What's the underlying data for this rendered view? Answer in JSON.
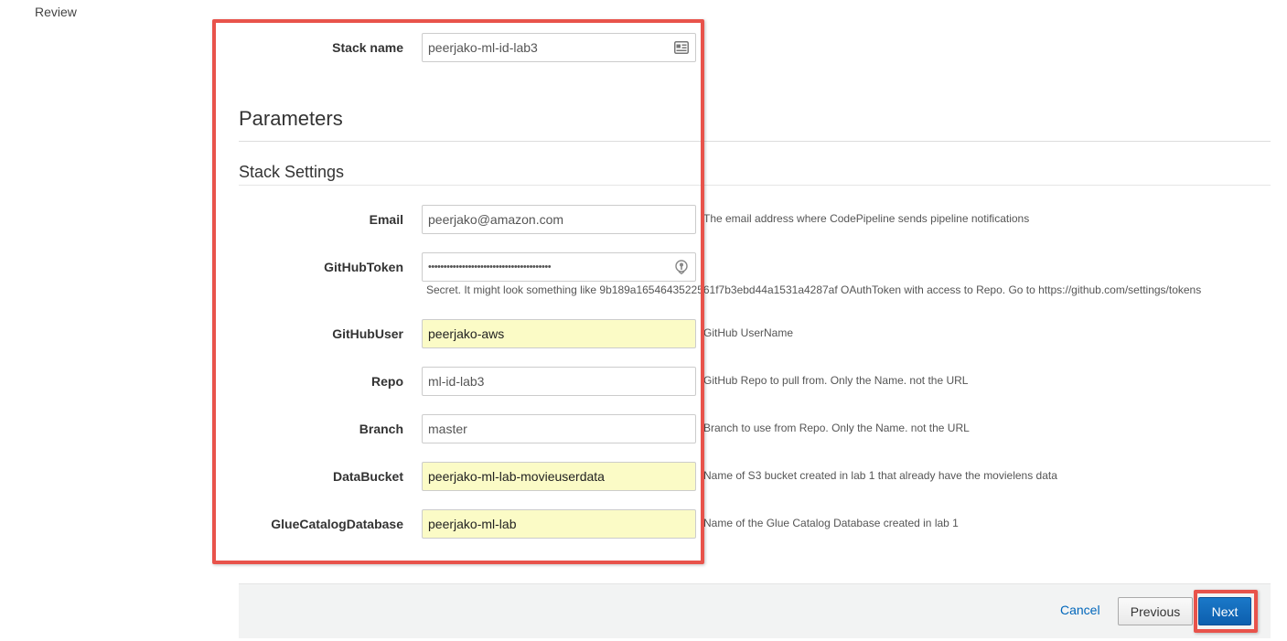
{
  "nav": {
    "review_label": "Review"
  },
  "stack": {
    "name_label": "Stack name",
    "name_value": "peerjako-ml-id-lab3"
  },
  "parameters": {
    "title": "Parameters",
    "subtitle": "Stack Settings"
  },
  "fields": {
    "email": {
      "label": "Email",
      "value": "peerjako@amazon.com",
      "description": "The email address where CodePipeline sends pipeline notifications"
    },
    "github_token": {
      "label": "GitHubToken",
      "value": "••••••••••••••••••••••••••••••••••••••••",
      "description": "Secret. It might look something like 9b189a1654643522561f7b3ebd44a1531a4287af OAuthToken with access to Repo. Go to https://github.com/settings/tokens"
    },
    "github_user": {
      "label": "GitHubUser",
      "value": "peerjako-aws",
      "description": "GitHub UserName"
    },
    "repo": {
      "label": "Repo",
      "value": "ml-id-lab3",
      "description": "GitHub Repo to pull from. Only the Name. not the URL"
    },
    "branch": {
      "label": "Branch",
      "value": "master",
      "description": "Branch to use from Repo. Only the Name. not the URL"
    },
    "data_bucket": {
      "label": "DataBucket",
      "value": "peerjako-ml-lab-movieuserdata",
      "description": "Name of S3 bucket created in lab 1 that already have the movielens data"
    },
    "glue_db": {
      "label": "GlueCatalogDatabase",
      "value": "peerjako-ml-lab",
      "description": "Name of the Glue Catalog Database created in lab 1"
    }
  },
  "footer": {
    "cancel_label": "Cancel",
    "previous_label": "Previous",
    "next_label": "Next"
  },
  "icons": {
    "stack_name_field": "contact-card-icon",
    "token_field": "key-lock-icon"
  },
  "colors": {
    "highlight": "#e8534b",
    "primary": "#0d5fae",
    "autofill": "#fbfbc6",
    "link": "#0066bb"
  }
}
